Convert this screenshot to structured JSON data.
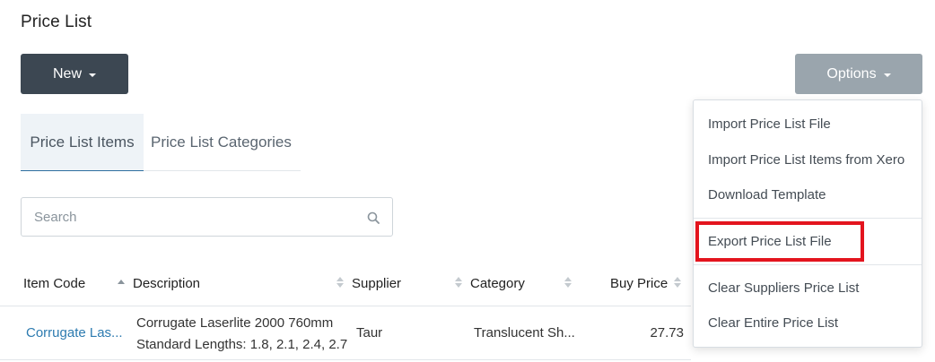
{
  "page": {
    "title": "Price List"
  },
  "toolbar": {
    "new_label": "New",
    "options_label": "Options"
  },
  "tabs": [
    {
      "label": "Price List Items",
      "active": true
    },
    {
      "label": "Price List Categories",
      "active": false
    }
  ],
  "search": {
    "placeholder": "Search",
    "value": ""
  },
  "table": {
    "columns": [
      "Item Code",
      "Description",
      "Supplier",
      "Category",
      "Buy Price"
    ],
    "sorted_column": "Item Code",
    "rows": [
      {
        "item_code": "Corrugate Las...",
        "description_line1": "Corrugate Laserlite 2000 760mm",
        "description_line2": "Standard Lengths: 1.8, 2.1, 2.4, 2.7,",
        "supplier": "Taur",
        "category": "Translucent Sh...",
        "buy_price": "27.73"
      }
    ]
  },
  "options_menu": {
    "items": [
      "Import Price List File",
      "Import Price List Items from Xero",
      "Download Template",
      "Export Price List File",
      "Clear Suppliers Price List",
      "Clear Entire Price List"
    ],
    "highlighted": "Export Price List File",
    "highlight_color": "#e3141e"
  },
  "colors": {
    "primary_dark": "#3c4752",
    "options_gray": "#9aa5ad",
    "link": "#2d7bb0"
  }
}
